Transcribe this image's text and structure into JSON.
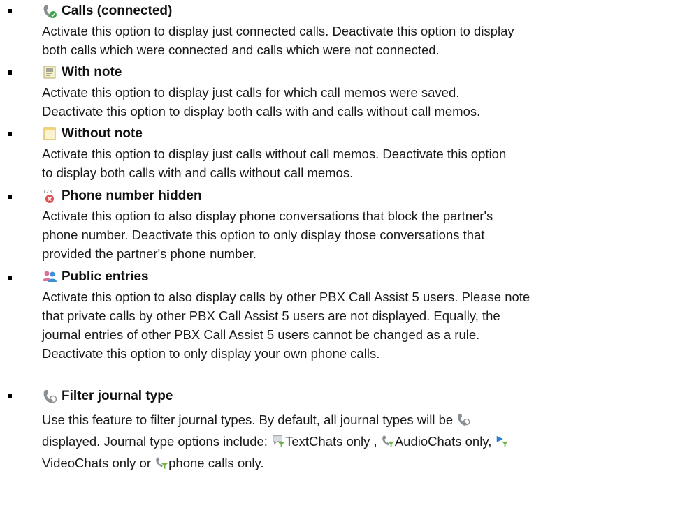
{
  "items": [
    {
      "icon": "phone-connected-icon",
      "title": "Calls (connected)",
      "lines": [
        "Activate this option to display just connected calls. Deactivate this option to display",
        "both calls which were connected and calls which were not connected."
      ]
    },
    {
      "icon": "note-icon",
      "title": "With note",
      "lines": [
        "Activate this option to display just calls for which call memos were saved.",
        "Deactivate this option to display both calls with and calls without call memos."
      ]
    },
    {
      "icon": "blank-note-icon",
      "title": "Without note",
      "lines": [
        "Activate this option to display just calls without call memos. Deactivate this option",
        "to display both calls with and calls without call memos."
      ]
    },
    {
      "icon": "hidden-number-icon",
      "icon_text": "123",
      "title": "Phone number hidden",
      "lines": [
        "Activate this option to also display phone conversations that block the partner's",
        "phone number. Deactivate this option to only display those conversations that",
        "provided the partner's phone number."
      ]
    },
    {
      "icon": "public-users-icon",
      "title": "Public entries",
      "lines": [
        "Activate this option to also display calls by other PBX Call Assist 5 users. Please note",
        "that private calls by other PBX Call Assist 5 users are not displayed. Equally, the",
        "journal entries of other PBX Call Assist 5 users cannot be changed as a rule.",
        "Deactivate this option to only display your own phone calls."
      ]
    },
    {
      "icon": "journal-filter-icon",
      "title": "Filter journal type",
      "line1": "Use this feature to filter journal types. By default, all journal types will be",
      "line2_a": "displayed. Journal type options include:",
      "line2_b": "TextChats only ,",
      "line2_c": "AudioChats only,",
      "line3_a": "VideoChats only or",
      "line3_b": "phone calls only."
    }
  ]
}
